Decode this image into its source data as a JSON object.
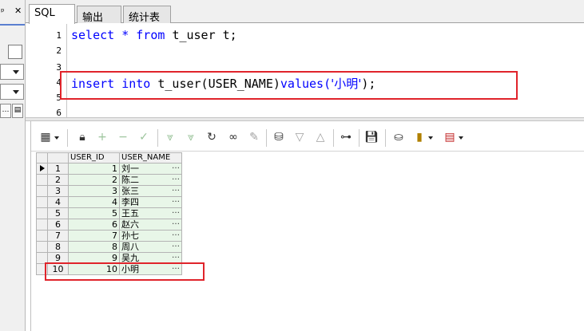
{
  "tabs": [
    {
      "label": "SQL"
    },
    {
      "label": "输出"
    },
    {
      "label": "统计表"
    }
  ],
  "editor": {
    "line_numbers": [
      "1",
      "2",
      "3",
      "4",
      "5",
      "6"
    ],
    "line1": {
      "kw1": "select",
      "star": "*",
      "kw2": "from",
      "rest": "t_user t;"
    },
    "line4": {
      "kw1": "insert",
      "kw2": "into",
      "table": "t_user(USER_NAME)",
      "kw3": "values(",
      "str": "'小明'",
      "end": ");"
    }
  },
  "grid": {
    "columns": [
      "USER_ID",
      "USER_NAME"
    ],
    "ellipsis": "…",
    "rows": [
      {
        "num": "1",
        "id": "1",
        "name": "刘一"
      },
      {
        "num": "2",
        "id": "2",
        "name": "陈二"
      },
      {
        "num": "3",
        "id": "3",
        "name": "张三"
      },
      {
        "num": "4",
        "id": "4",
        "name": "李四"
      },
      {
        "num": "5",
        "id": "5",
        "name": "王五"
      },
      {
        "num": "6",
        "id": "6",
        "name": "赵六"
      },
      {
        "num": "7",
        "id": "7",
        "name": "孙七"
      },
      {
        "num": "8",
        "id": "8",
        "name": "周八"
      },
      {
        "num": "9",
        "id": "9",
        "name": "吴九"
      },
      {
        "num": "10",
        "id": "10",
        "name": "小明"
      }
    ]
  },
  "colors": {
    "highlight": "#e0242b",
    "keyword": "#0000ff",
    "cell_bg": "#e8f6e8"
  },
  "icons": [
    "pin-icon",
    "grid-view-icon",
    "lock-icon",
    "add-record-icon",
    "delete-record-icon",
    "post-changes-icon",
    "fetch-next-icon",
    "fetch-last-icon",
    "refresh-icon",
    "find-icon",
    "clear-icon",
    "query-by-example-icon",
    "filter-icon",
    "sort-icon",
    "link-icon",
    "save-icon",
    "export-icon",
    "chart-icon",
    "table-icon"
  ]
}
